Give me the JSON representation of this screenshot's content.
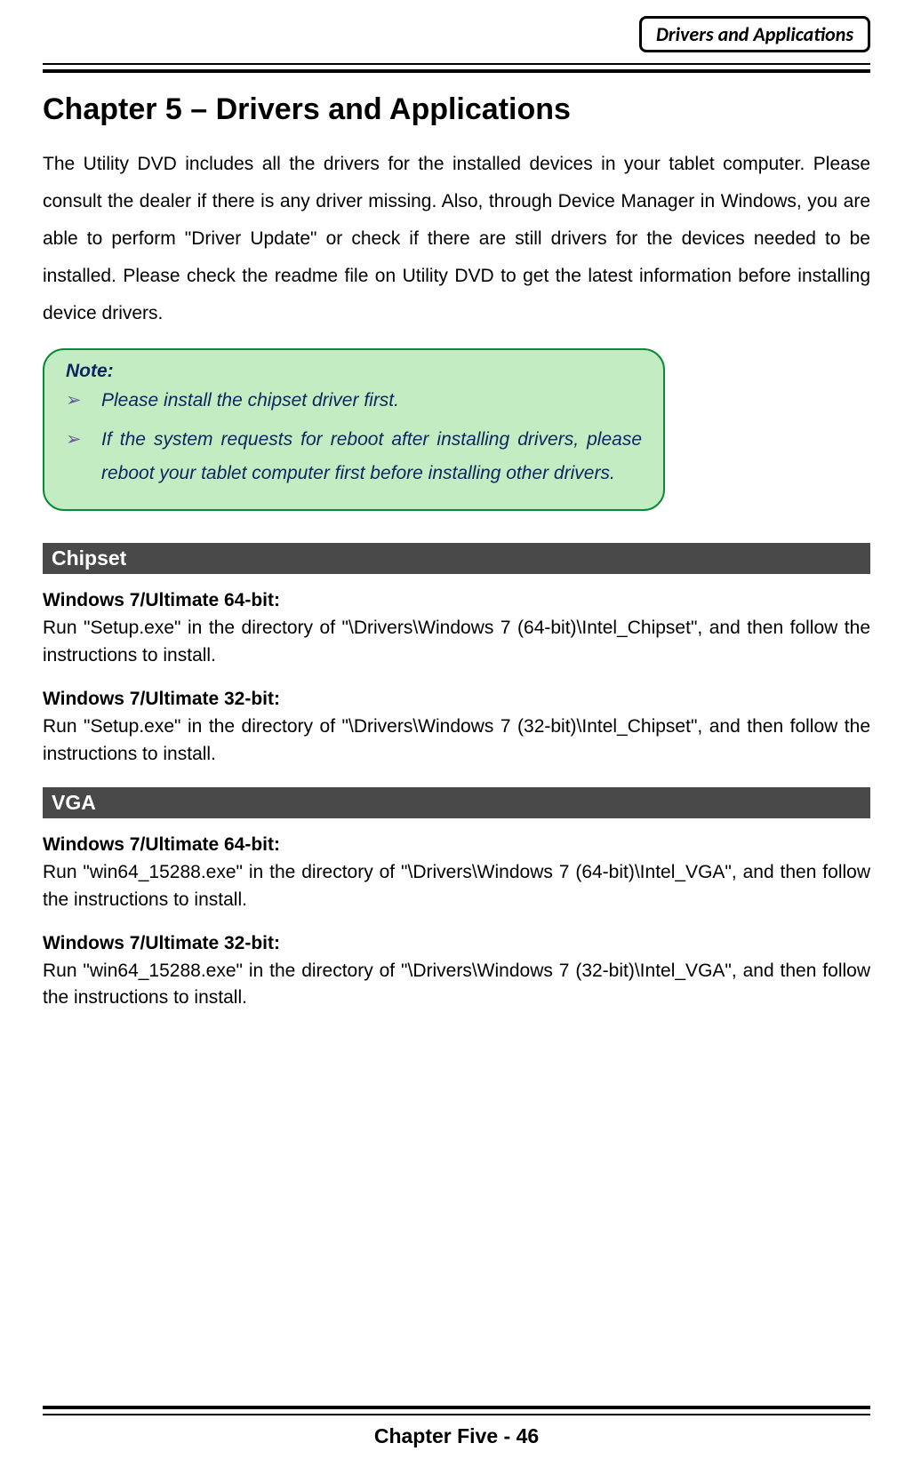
{
  "header": {
    "tag": "Drivers and Applications"
  },
  "chapter": {
    "title": "Chapter 5 – Drivers and Applications",
    "intro": "The Utility DVD includes all the drivers for the installed devices in your tablet computer. Please consult the dealer if there is any driver missing. Also, through Device Manager in Windows, you are able to perform \"Driver Update\" or check if there are still drivers for the devices needed to be installed. Please check the readme file on Utility DVD to get the latest information before installing device drivers."
  },
  "note": {
    "title": "Note:",
    "items": [
      "Please install the chipset driver first.",
      "If the system requests for reboot after installing drivers, please reboot your tablet computer first before installing other drivers."
    ]
  },
  "sections": [
    {
      "title": "Chipset",
      "entries": [
        {
          "heading": "Windows 7/Ultimate 64-bit:",
          "text": "Run \"Setup.exe\" in the directory of \"\\Drivers\\Windows 7 (64-bit)\\Intel_Chipset\", and then follow the instructions to install."
        },
        {
          "heading": "Windows 7/Ultimate 32-bit:",
          "text": "Run \"Setup.exe\" in the directory of \"\\Drivers\\Windows 7 (32-bit)\\Intel_Chipset\", and then follow the instructions to install."
        }
      ]
    },
    {
      "title": "VGA",
      "entries": [
        {
          "heading": "Windows 7/Ultimate 64-bit:",
          "text": "Run \"win64_15288.exe\" in the directory of \"\\Drivers\\Windows 7 (64-bit)\\Intel_VGA\", and then follow the instructions to install."
        },
        {
          "heading": "Windows 7/Ultimate 32-bit:",
          "text": "Run \"win64_15288.exe\" in the directory of \"\\Drivers\\Windows 7 (32-bit)\\Intel_VGA\", and then follow the instructions to install."
        }
      ]
    }
  ],
  "footer": {
    "label": "Chapter Five - 46"
  }
}
